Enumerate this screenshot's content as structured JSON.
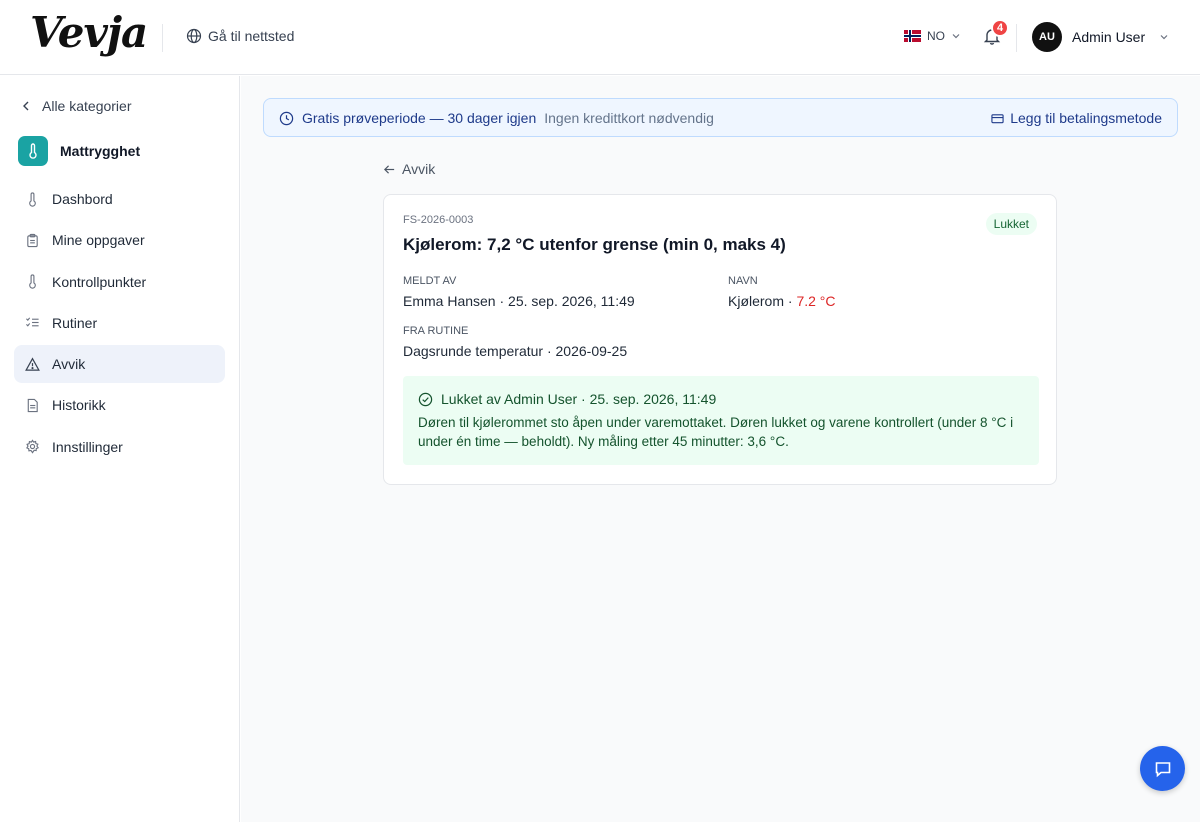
{
  "header": {
    "logo": "Vevja",
    "goto_site": "Gå til nettsted",
    "language": "NO",
    "notification_count": "4",
    "user_initials": "AU",
    "user_name": "Admin User"
  },
  "sidebar": {
    "back_label": "Alle kategorier",
    "category_title": "Mattrygghet",
    "items": [
      {
        "label": "Dashbord",
        "icon": "thermometer-icon"
      },
      {
        "label": "Mine oppgaver",
        "icon": "clipboard-icon"
      },
      {
        "label": "Kontrollpunkter",
        "icon": "thermometer-icon"
      },
      {
        "label": "Rutiner",
        "icon": "checklist-icon"
      },
      {
        "label": "Avvik",
        "icon": "warning-triangle-icon",
        "active": true
      },
      {
        "label": "Historikk",
        "icon": "document-icon"
      },
      {
        "label": "Innstillinger",
        "icon": "gear-icon"
      }
    ]
  },
  "trial_banner": {
    "title": "Gratis prøveperiode — 30 dager igjen",
    "subtitle": "Ingen kredittkort nødvendig",
    "action": "Legg til betalingsmetode"
  },
  "back_link": "Avvik",
  "deviation": {
    "id": "FS-2026-0003",
    "status": "Lukket",
    "title": "Kjølerom: 7,2 °C utenfor grense (min 0, maks 4)",
    "reported_by_label": "MELDT AV",
    "reported_by_value": "Emma Hansen · 25. sep. 2026, 11:49",
    "name_label": "NAVN",
    "name_value": "Kjølerom · ",
    "name_temp": "7.2 °C",
    "routine_label": "FRA RUTINE",
    "routine_value": "Dagsrunde temperatur · 2026-09-25",
    "closed_by": "Lukket av Admin User · 25. sep. 2026, 11:49",
    "closed_text": "Døren til kjølerommet sto åpen under varemottaket. Døren lukket og varene kontrollert (under 8 °C i under én time — beholdt). Ny måling etter 45 minutter: 3,6 °C."
  },
  "colors": {
    "accent": "#2563eb",
    "category_icon": "#1aa3a3",
    "success_bg": "#ecfdf3",
    "danger": "#dc2626"
  }
}
